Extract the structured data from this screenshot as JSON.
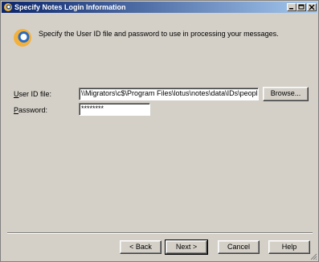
{
  "window": {
    "title": "Specify Notes Login Information"
  },
  "intro": {
    "text": "Specify the User ID file and password to use in processing your messages."
  },
  "form": {
    "userid_label_mnemonic": "U",
    "userid_label_rest": "ser ID file:",
    "userid_value": "\\\\Migrators\\c$\\Program Files\\lotus\\notes\\data\\IDs\\people\\d",
    "browse_label": "Browse...",
    "password_label_mnemonic": "P",
    "password_label_rest": "assword:",
    "password_value": "********"
  },
  "buttons": {
    "back": "< Back",
    "next": "Next >",
    "cancel": "Cancel",
    "help": "Help"
  },
  "colors": {
    "titlebar_start": "#0a246a",
    "titlebar_end": "#a6caf0",
    "dialog_bg": "#d4d0c8"
  }
}
